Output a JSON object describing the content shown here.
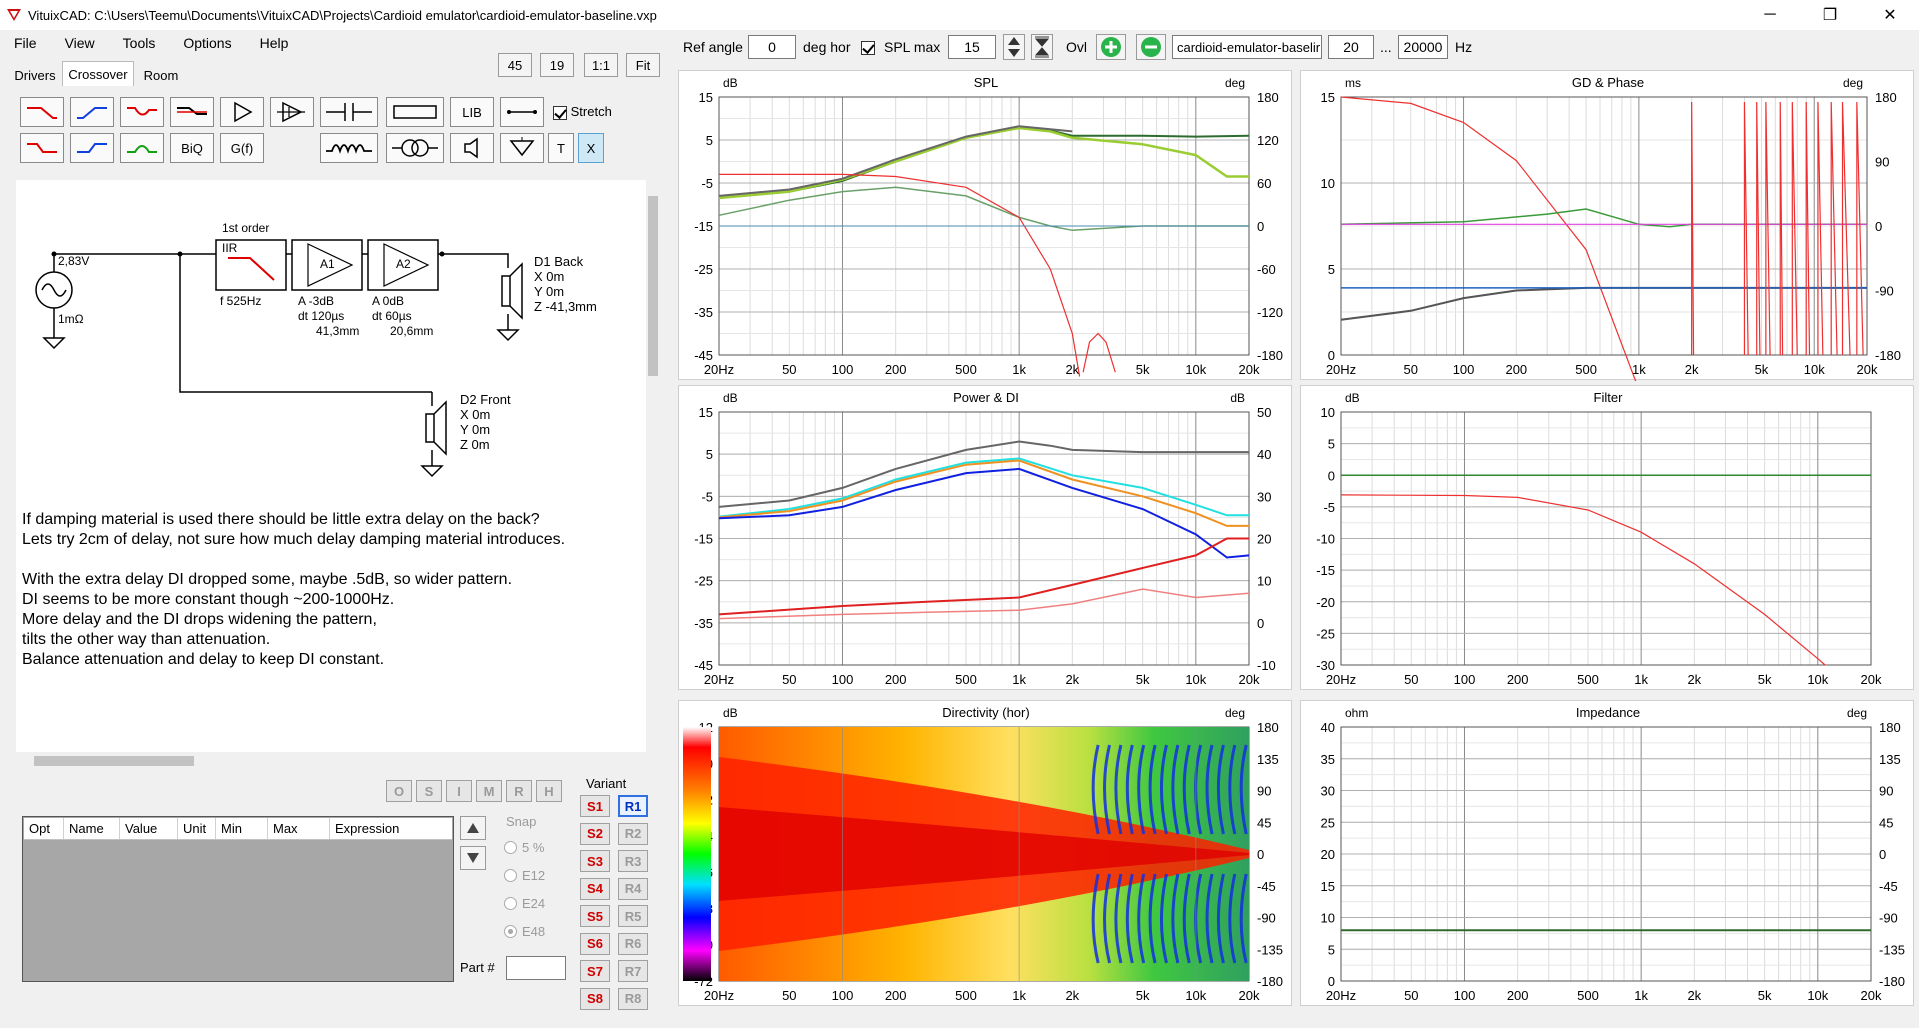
{
  "window": {
    "title": "VituixCAD: C:\\Users\\Teemu\\Documents\\VituixCAD\\Projects\\Cardioid emulator\\cardioid-emulator-baseline.vxp",
    "minimize": "─",
    "maximize": "❐",
    "close": "✕"
  },
  "menu": [
    "File",
    "View",
    "Tools",
    "Options",
    "Help"
  ],
  "zoom_buttons": [
    "45",
    "19",
    "1:1",
    "Fit"
  ],
  "tabs": [
    "Drivers",
    "Crossover",
    "Room"
  ],
  "palette": {
    "biq": "BiQ",
    "gf": "G(f)",
    "lib": "LIB",
    "t": "T",
    "x": "X",
    "stretch": "Stretch"
  },
  "schematic": {
    "source_voltage": "2,83V",
    "source_res": "1mΩ",
    "block_title": "1st order",
    "iir_label": "IIR",
    "iir_f": "f   525Hz",
    "a1_name": "A1",
    "a1_params": [
      "A  -3dB",
      "dt 120µs",
      "41,3mm"
    ],
    "a2_name": "A2",
    "a2_params": [
      "A  0dB",
      "dt 60µs",
      "20,6mm"
    ],
    "d1": [
      "D1 Back",
      "X 0m",
      "Y 0m",
      "Z -41,3mm"
    ],
    "d2": [
      "D2 Front",
      "X 0m",
      "Y 0m",
      "Z 0m"
    ]
  },
  "notes": "If damping material is used there should be little extra delay on the back?\nLets try 2cm of delay, not sure how much delay damping material introduces.\n\nWith the extra delay DI dropped some, maybe .5dB, so wider pattern.\nDI seems to be more constant though ~200-1000Hz.\nMore delay and the DI drops widening the pattern,\ntilts the other way than attenuation.\nBalance attenuation and delay to keep DI constant.",
  "opt_buttons": [
    "O",
    "S",
    "I",
    "M",
    "R",
    "H"
  ],
  "variant_label": "Variant",
  "s_variants": [
    "S1",
    "S2",
    "S3",
    "S4",
    "S5",
    "S6",
    "S7",
    "S8"
  ],
  "r_variants": [
    "R1",
    "R2",
    "R3",
    "R4",
    "R5",
    "R6",
    "R7",
    "R8"
  ],
  "table_headers": [
    "Opt",
    "Name",
    "Value",
    "Unit",
    "Min",
    "Max",
    "Expression"
  ],
  "snap": {
    "label": "Snap",
    "options": [
      "5 %",
      "E12",
      "E24",
      "E48"
    ],
    "selected": "E48"
  },
  "part_label": "Part #",
  "toolbar": {
    "ref_angle_label": "Ref angle",
    "ref_angle_value": "0",
    "deg_hor": "deg hor",
    "spl_max_label": "SPL max",
    "spl_max_value": "15",
    "ovl": "Ovl",
    "file_value": "cardioid-emulator-baselir",
    "f_min": "20",
    "ellipsis": "...",
    "f_max": "20000",
    "hz": "Hz"
  },
  "freq_ticks": [
    "20Hz",
    "50",
    "100",
    "200",
    "500",
    "1k",
    "2k",
    "5k",
    "10k",
    "20k"
  ],
  "plots": {
    "spl": {
      "title": "SPL",
      "left_unit": "dB",
      "right_unit": "deg",
      "left_ticks": [
        "15",
        "5",
        "-5",
        "-15",
        "-25",
        "-35",
        "-45"
      ],
      "right_ticks": [
        "180",
        "120",
        "60",
        "0",
        "-60",
        "-120",
        "-180"
      ]
    },
    "gd": {
      "title": "GD & Phase",
      "left_unit": "ms",
      "right_unit": "deg",
      "left_ticks": [
        "15",
        "10",
        "5",
        "0"
      ],
      "right_ticks": [
        "180",
        "90",
        "0",
        "-90",
        "-180"
      ]
    },
    "power": {
      "title": "Power & DI",
      "left_unit": "dB",
      "right_unit": "dB",
      "left_ticks": [
        "15",
        "5",
        "-5",
        "-15",
        "-25",
        "-35",
        "-45"
      ],
      "right_ticks": [
        "50",
        "40",
        "30",
        "20",
        "10",
        "0",
        "-10"
      ]
    },
    "filter": {
      "title": "Filter",
      "left_unit": "dB",
      "left_ticks": [
        "10",
        "5",
        "0",
        "-5",
        "-10",
        "-15",
        "-20",
        "-25",
        "-30"
      ]
    },
    "directivity": {
      "title": "Directivity (hor)",
      "left_unit": "dB",
      "right_unit": "deg",
      "left_ticks": [
        "12",
        "0",
        "-12",
        "-24",
        "-36",
        "-48",
        "-60",
        "-72"
      ],
      "right_ticks": [
        "180",
        "135",
        "90",
        "45",
        "0",
        "-45",
        "-90",
        "-135",
        "-180"
      ]
    },
    "impedance": {
      "title": "Impedance",
      "left_unit": "ohm",
      "right_unit": "deg",
      "left_ticks": [
        "40",
        "35",
        "30",
        "25",
        "20",
        "15",
        "10",
        "5",
        "0"
      ],
      "right_ticks": [
        "180",
        "135",
        "90",
        "45",
        "0",
        "-45",
        "-90",
        "-135",
        "-180"
      ]
    }
  }
}
